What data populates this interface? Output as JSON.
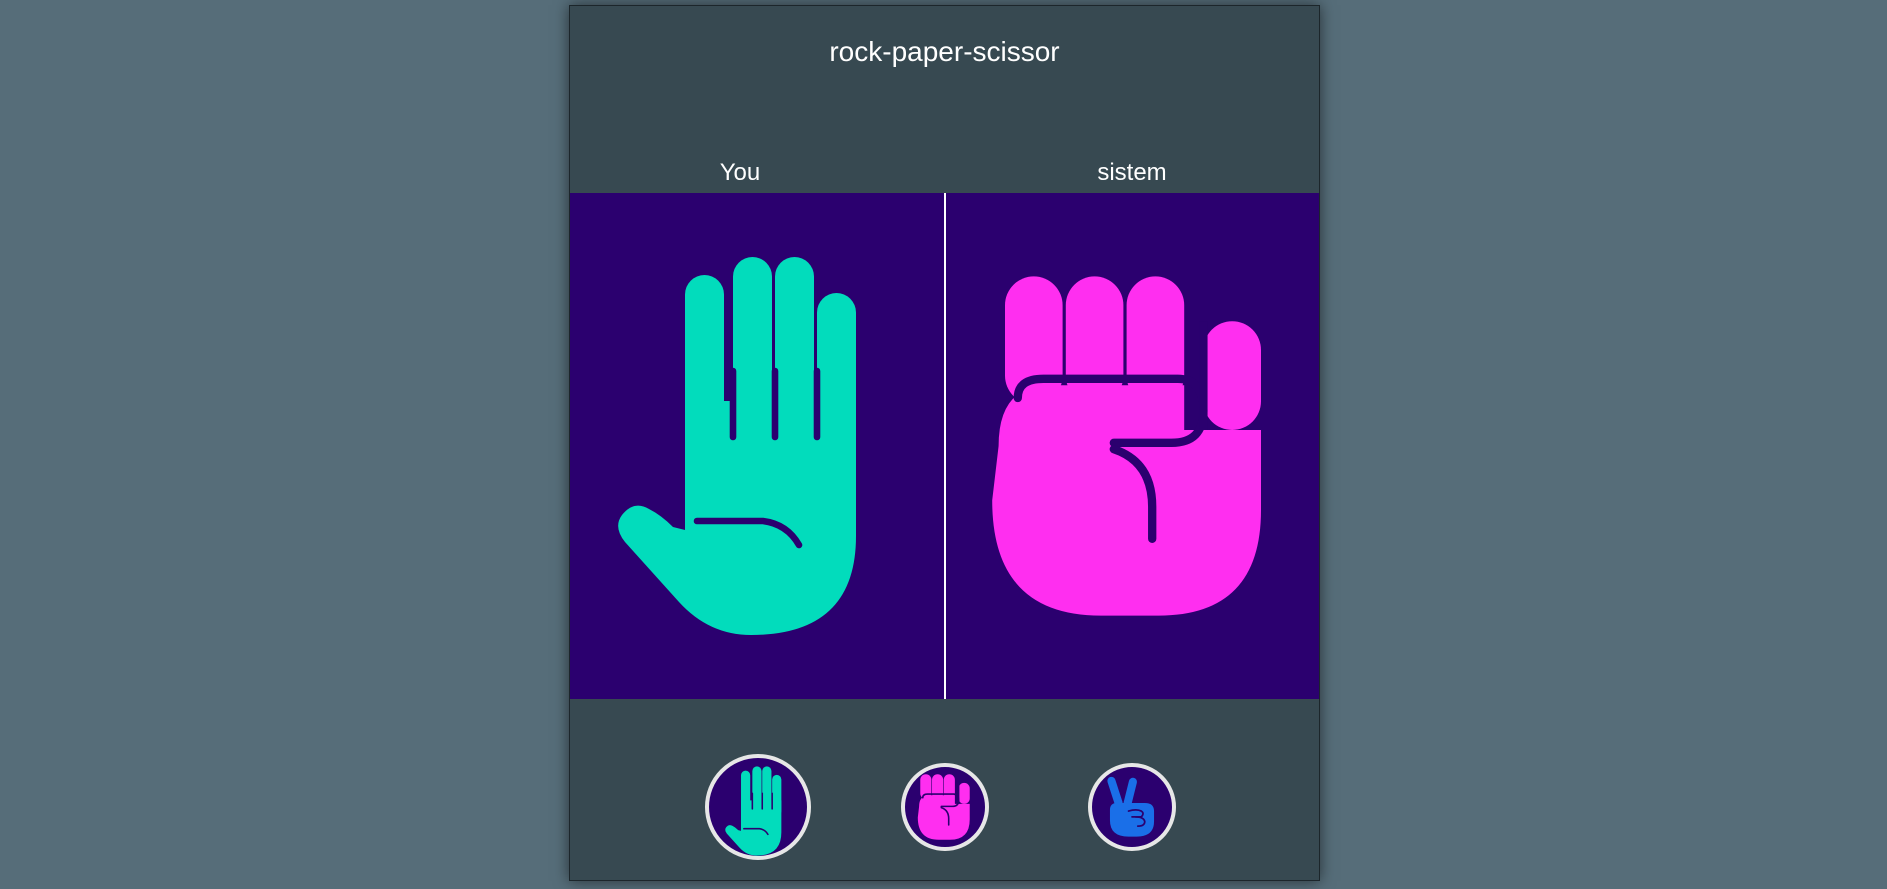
{
  "app": {
    "title": "rock-paper-scissor"
  },
  "players": {
    "you_label": "You",
    "system_label": "sistem"
  },
  "arena": {
    "your_choice": "paper",
    "system_choice": "rock",
    "background_color": "#2b006f"
  },
  "choices": [
    {
      "name": "paper",
      "icon": "paper-hand-icon",
      "color": "#02dcbc",
      "selected": true
    },
    {
      "name": "rock",
      "icon": "rock-fist-icon",
      "color": "#ff2ef0",
      "selected": false
    },
    {
      "name": "scissor",
      "icon": "scissor-hand-icon",
      "color": "#1a6fe8",
      "selected": false
    }
  ],
  "colors": {
    "page_background": "#566d79",
    "card_background": "#374951",
    "paper": "#02dcbc",
    "rock": "#ff2ef0",
    "scissor": "#1a6fe8"
  }
}
